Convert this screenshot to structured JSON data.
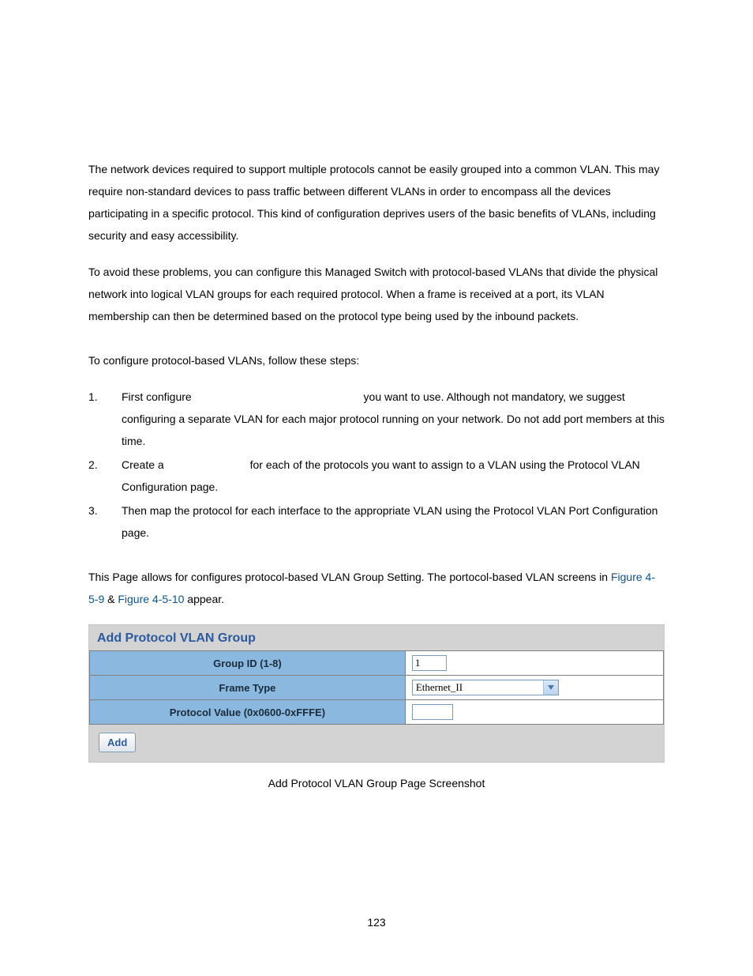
{
  "paragraphs": {
    "p1": "The network devices required to support multiple protocols cannot be easily grouped into a common VLAN. This may require non-standard devices to pass traffic between different VLANs in order to encompass all the devices participating in a specific protocol. This kind of configuration deprives users of the basic benefits of VLANs, including security and easy accessibility.",
    "p2": "To avoid these problems, you can configure this Managed Switch with protocol-based VLANs that divide the physical network into logical VLAN groups for each required protocol. When a frame is received at a port, its VLAN membership can then be determined based on the protocol type being used by the inbound packets.",
    "p3": "To configure protocol-based VLANs, follow these steps:",
    "step1_a": "First configure ",
    "step1_b": " you want to use. Although not mandatory, we suggest configuring a separate VLAN for each major protocol running on your network. Do not add port members at this time.",
    "step1_blank": "                                                      ",
    "step2_a": "Create a ",
    "step2_b": " for each of the protocols you want to assign to a VLAN using the Protocol VLAN Configuration page.",
    "step2_blank": "                          ",
    "step3": "Then map the protocol for each interface to the appropriate VLAN using the Protocol VLAN Port Configuration page.",
    "p4_a": "This Page allows for configures protocol-based VLAN Group Setting. The portocol-based VLAN screens in ",
    "p4_link1": "Figure 4-5-9",
    "p4_mid": " & ",
    "p4_link2": "Figure 4-5-10",
    "p4_b": " appear."
  },
  "panel": {
    "title": "Add Protocol VLAN Group",
    "rows": {
      "group_id_label": "Group ID (1-8)",
      "group_id_value": "1",
      "frame_type_label": "Frame Type",
      "frame_type_value": "Ethernet_II",
      "protocol_value_label": "Protocol Value (0x0600-0xFFFE)",
      "protocol_value_value": ""
    },
    "add_button": "Add"
  },
  "caption": "Add Protocol VLAN Group Page Screenshot",
  "page_number": "123"
}
